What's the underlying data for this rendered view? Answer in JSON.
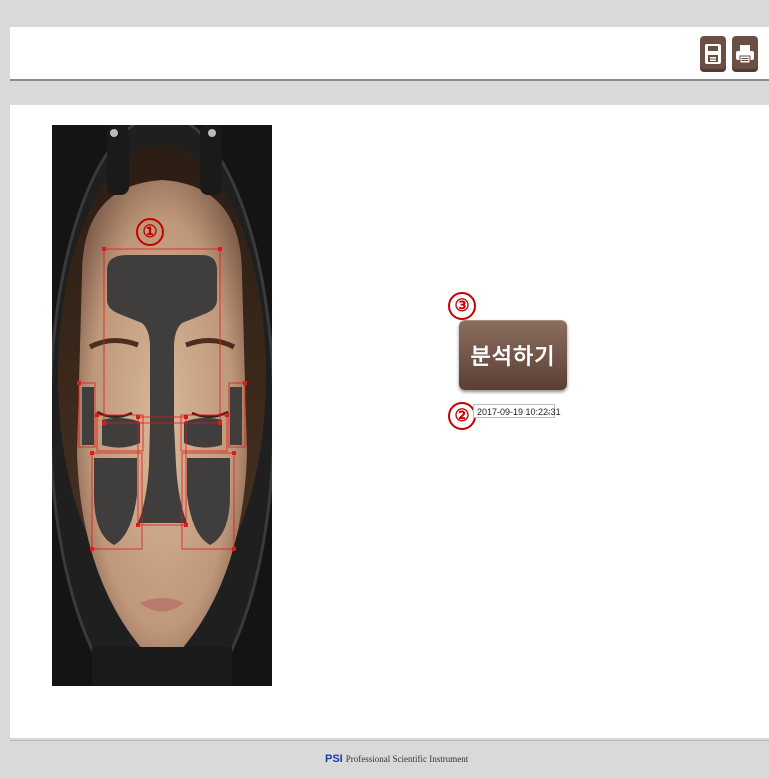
{
  "toolbar": {
    "save_icon": "save-icon",
    "print_icon": "print-icon"
  },
  "markers": {
    "m1": "①",
    "m2": "②",
    "m3": "③"
  },
  "analyze_button": {
    "label": "분석하기"
  },
  "date_select": {
    "value": "2017-09-19 10:22:31",
    "caret": "⌄"
  },
  "footer": {
    "logo_text": "PSI",
    "tagline": "Professional Scientific Instrument"
  },
  "colors": {
    "button_brown": "#6b4f42",
    "marker_red": "#c40000",
    "mask": "#3f3e3d"
  }
}
